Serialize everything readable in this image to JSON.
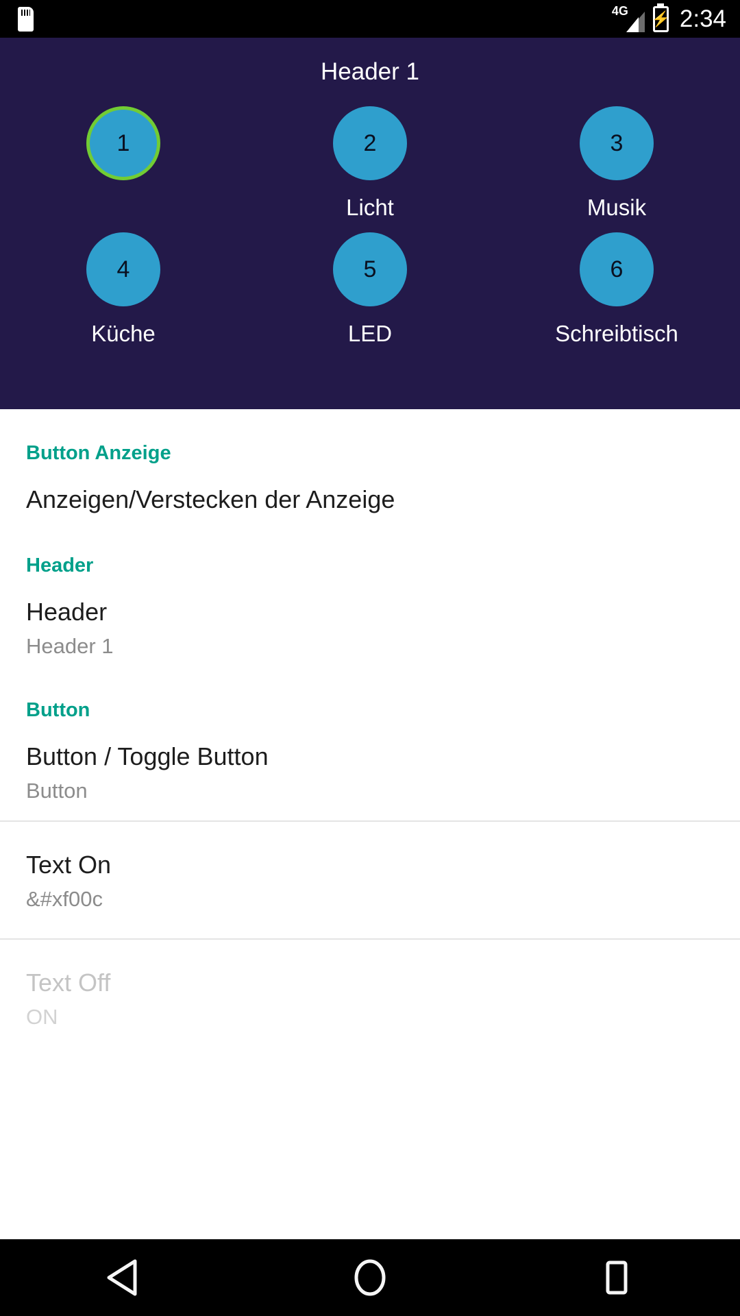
{
  "status_bar": {
    "sd_icon": "sdcard-icon",
    "network_label": "4G",
    "signal_icon": "signal-bars-icon",
    "battery_icon": "battery-charging-icon",
    "battery_glyph": "⚡",
    "time": "2:34"
  },
  "header_panel": {
    "title": "Header 1",
    "background_color": "#231949",
    "button_color": "#2f9fcd",
    "selected_border_color": "#72cc34",
    "buttons": [
      {
        "number": "1",
        "label": "",
        "selected": true
      },
      {
        "number": "2",
        "label": "Licht",
        "selected": false
      },
      {
        "number": "3",
        "label": "Musik",
        "selected": false
      },
      {
        "number": "4",
        "label": "Küche",
        "selected": false
      },
      {
        "number": "5",
        "label": "LED",
        "selected": false
      },
      {
        "number": "6",
        "label": "Schreibtisch",
        "selected": false
      }
    ]
  },
  "preferences": {
    "accent_color": "#00a08a",
    "sections": [
      {
        "category": "Button Anzeige",
        "items": [
          {
            "title": "Anzeigen/Verstecken der Anzeige",
            "summary": "",
            "disabled": false,
            "divider": false
          }
        ]
      },
      {
        "category": "Header",
        "items": [
          {
            "title": "Header",
            "summary": "Header 1",
            "disabled": false,
            "divider": false
          }
        ]
      },
      {
        "category": "Button",
        "items": [
          {
            "title": "Button / Toggle Button",
            "summary": "Button",
            "disabled": false,
            "divider": false
          },
          {
            "title": "Text On",
            "summary": "&#xf00c",
            "disabled": false,
            "divider": true
          },
          {
            "title": "Text Off",
            "summary": "ON",
            "disabled": true,
            "divider": true
          }
        ]
      }
    ]
  },
  "nav_bar": {
    "back_label": "back-icon",
    "home_label": "home-icon",
    "recents_label": "recents-icon"
  }
}
